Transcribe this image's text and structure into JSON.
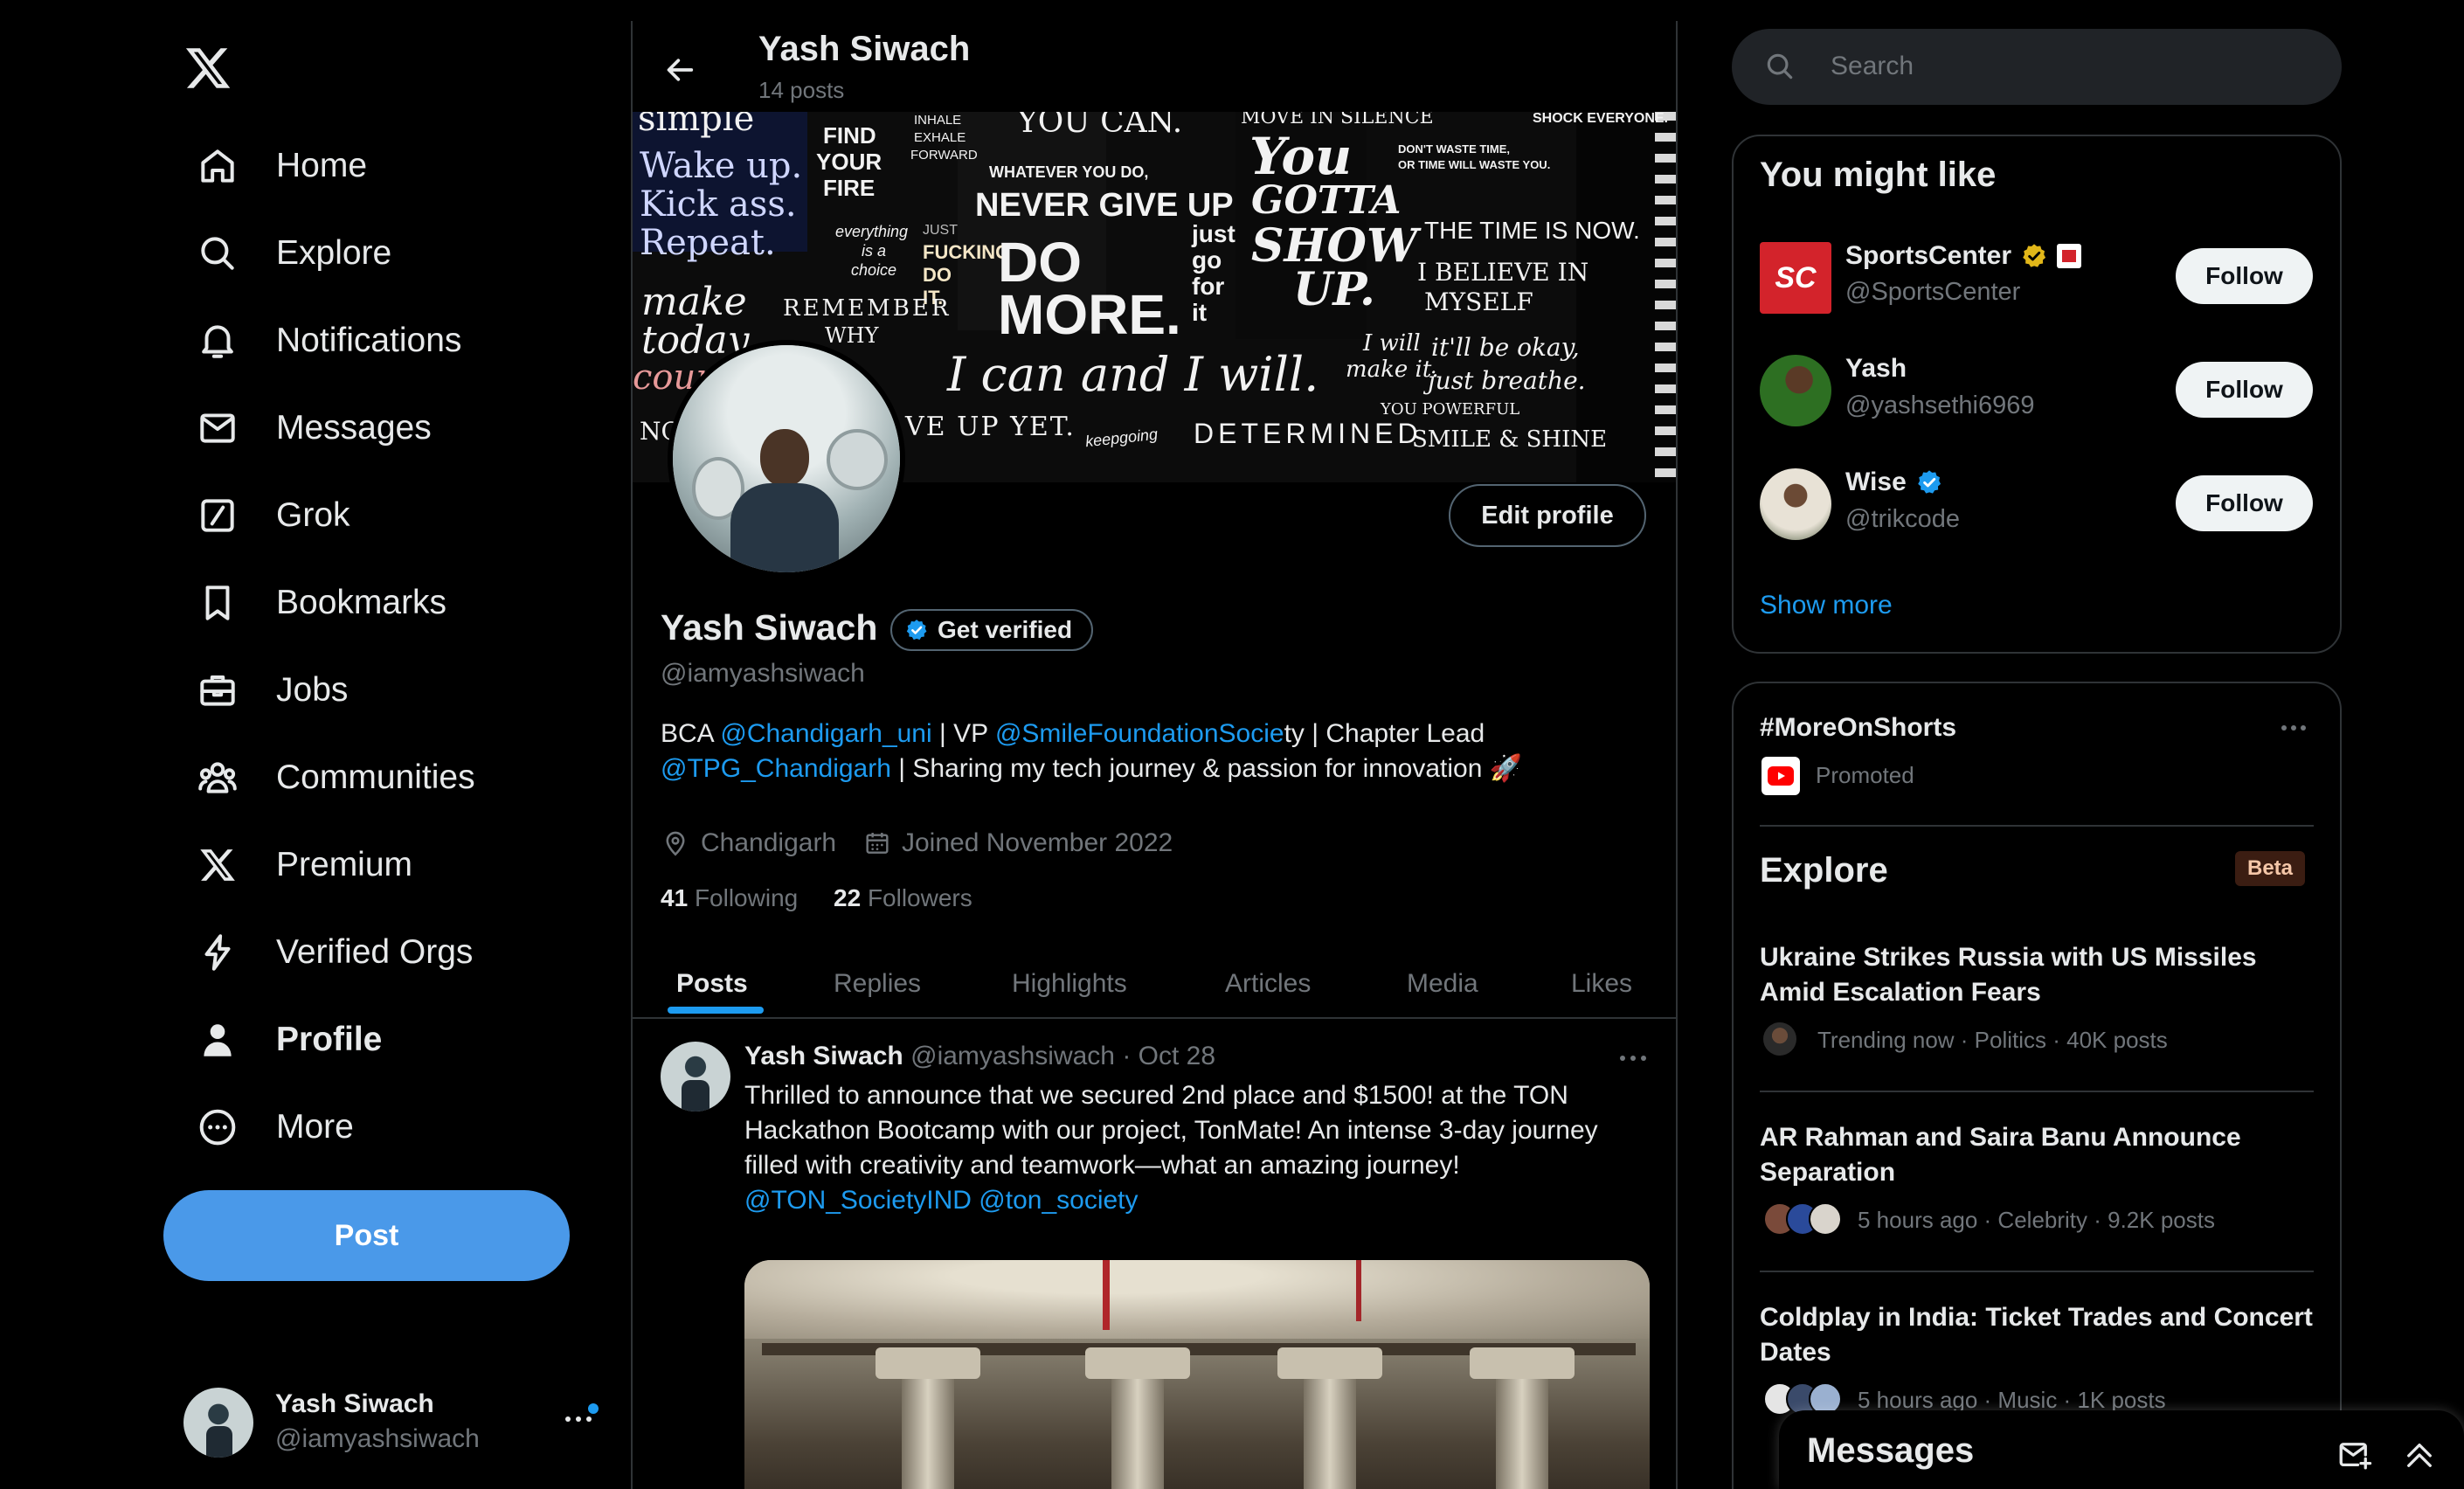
{
  "nav": {
    "items": [
      {
        "label": "Home",
        "icon": "home-icon"
      },
      {
        "label": "Explore",
        "icon": "search-icon"
      },
      {
        "label": "Notifications",
        "icon": "bell-icon"
      },
      {
        "label": "Messages",
        "icon": "envelope-icon"
      },
      {
        "label": "Grok",
        "icon": "grok-icon"
      },
      {
        "label": "Bookmarks",
        "icon": "bookmark-icon"
      },
      {
        "label": "Jobs",
        "icon": "briefcase-icon"
      },
      {
        "label": "Communities",
        "icon": "people-icon"
      },
      {
        "label": "Premium",
        "icon": "x-logo-icon"
      },
      {
        "label": "Verified Orgs",
        "icon": "lightning-icon"
      },
      {
        "label": "Profile",
        "icon": "person-icon"
      },
      {
        "label": "More",
        "icon": "more-circle-icon"
      }
    ],
    "post_label": "Post"
  },
  "account": {
    "name": "Yash Siwach",
    "handle": "@iamyashsiwach"
  },
  "header": {
    "name": "Yash Siwach",
    "post_count": "14 posts"
  },
  "banner": {
    "phrases": [
      "simple",
      "Wake up.",
      "Kick ass.",
      "Repeat.",
      "make",
      "today",
      "count",
      "FIND",
      "YOUR",
      "FIRE",
      "INHALE",
      "EXHALE",
      "FORWARD",
      "YOU CAN.",
      "WHATEVER YOU DO,",
      "NEVER GIVE UP",
      "everything",
      "is a",
      "choice",
      "JUST",
      "FUCKING",
      "DO",
      "IT.",
      "DO",
      "MORE.",
      "REMEMBER",
      "WHY",
      "I can and I will.",
      "NOT",
      "VE UP YET.",
      "keepgoing",
      "DETERMINED",
      "MOVE IN SILENCE",
      "You",
      "GOTTA",
      "SHOW",
      "UP.",
      "just",
      "go",
      "for",
      "it",
      "I will",
      "make it.",
      "DON'T WASTE TIME,",
      "OR TIME WILL WASTE YOU.",
      "THE TIME IS NOW.",
      "I BELIEVE IN",
      "MYSELF",
      "it'll be okay,",
      "just breathe.",
      "YOU POWERFUL",
      "SMILE & SHINE",
      "SHOCK EVERYONE."
    ]
  },
  "profile": {
    "name": "Yash Siwach",
    "get_verified": "Get verified",
    "handle": "@iamyashsiwach",
    "bio": {
      "p1": "BCA ",
      "link1": "@Chandigarh_uni",
      "p2": " | VP ",
      "link2": "@SmileFoundationSocie",
      "p3": "ty | Chapter Lead",
      "link3": "@TPG_Chandigarh",
      "p4": " | Sharing my tech journey & passion for innovation",
      "emoji": "🚀"
    },
    "location": "Chandigarh",
    "joined": "Joined November 2022",
    "following_count": "41",
    "following_label": "Following",
    "followers_count": "22",
    "followers_label": "Followers",
    "edit_label": "Edit profile"
  },
  "tabs": [
    "Posts",
    "Replies",
    "Highlights",
    "Articles",
    "Media",
    "Likes"
  ],
  "post": {
    "author": "Yash Siwach",
    "handle": "@iamyashsiwach",
    "dot": "·",
    "date": "Oct 28",
    "text": "Thrilled to announce that we secured 2nd place and $1500! at the TON Hackathon Bootcamp with our project, TonMate! An intense 3-day journey filled with creativity and teamwork—what an amazing journey!",
    "mentions": "@TON_SocietyIND @ton_society"
  },
  "search": {
    "placeholder": "Search"
  },
  "suggestions": {
    "title": "You might like",
    "follow_label": "Follow",
    "show_more": "Show more",
    "items": [
      {
        "name": "SportsCenter",
        "handle": "@SportsCenter",
        "avatar_text": "SC"
      },
      {
        "name": "Yash",
        "handle": "@yashsethi6969",
        "avatar_text": ""
      },
      {
        "name": "Wise",
        "handle": "@trikcode",
        "avatar_text": ""
      }
    ]
  },
  "promo": {
    "hashtag": "#MoreOnShorts",
    "label": "Promoted"
  },
  "explore": {
    "title": "Explore",
    "badge": "Beta",
    "trends": [
      {
        "title": "Ukraine Strikes Russia with US Missiles Amid Escalation Fears",
        "meta": "Trending now · Politics · 40K posts"
      },
      {
        "title": "AR Rahman and Saira Banu Announce Separation",
        "meta": "5 hours ago · Celebrity · 9.2K posts"
      },
      {
        "title": "Coldplay in India: Ticket Trades and Concert Dates",
        "meta": "5 hours ago · Music · 1K posts"
      }
    ]
  },
  "messages_dock": {
    "title": "Messages"
  },
  "colors": {
    "accent": "#1d9bf0",
    "post_button": "#4a99e9",
    "verified_blue": "#1d9bf0",
    "gold": "#e2b719",
    "beta_bg": "#3b1d12",
    "beta_text": "#f4c6a8"
  }
}
